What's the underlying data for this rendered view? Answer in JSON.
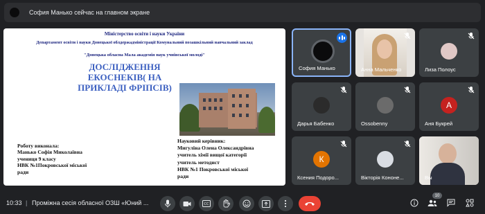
{
  "notification": {
    "text": "София Манько сейчас на главном экране"
  },
  "slide": {
    "line1": "Міністерство освіти і науки України",
    "line2": "Департамент освіти і науки Донецької облдержадміністрації  Комунальний позашкільний навчальний заклад",
    "line3": "\"Донецька обласна Мала академія наук учнівської молоді\"",
    "title": "ДОСЛІДЖЕННЯ  ЕКОСНЕКІВ( НА ПРИКЛАДІ ФРІПСІВ)",
    "left": [
      "Роботу виконала:",
      "Манько Софія Миколаївна",
      "учениця 9 класу",
      "НВК №1Покровської міської",
      "ради"
    ],
    "right": [
      "Науковий керівник:",
      "Мигуліна Олена Олександрівна",
      "учитель хімії вищої категорії",
      "учитель методист",
      "НВК №1 Покровської міської",
      "ради"
    ]
  },
  "participants": [
    {
      "name": "София Манько",
      "initial": ""
    },
    {
      "name": "Анна Мальченко",
      "initial": ""
    },
    {
      "name": "Лиза Полоус",
      "initial": ""
    },
    {
      "name": "Дарья Бабенко",
      "initial": ""
    },
    {
      "name": "Ossobenny",
      "initial": ""
    },
    {
      "name": "Аня Букрей",
      "initial": "А",
      "color": "#c5221f"
    },
    {
      "name": "Ксения Подоро...",
      "initial": "К",
      "color": "#e37400"
    },
    {
      "name": "Вікторія Кононе...",
      "initial": ""
    },
    {
      "name": "Вы",
      "initial": ""
    }
  ],
  "bottom_bar": {
    "time": "10:33",
    "separator": "|",
    "meeting_title": "Проміжна сесія обласної ОЗШ «Юний ...",
    "participant_count": "10"
  },
  "icons": [
    "mic-icon",
    "camera-icon",
    "captions-icon",
    "raise-hand-icon",
    "emoji-icon",
    "present-icon",
    "more-icon",
    "end-call-icon",
    "info-icon",
    "people-icon",
    "chat-icon",
    "activities-icon"
  ],
  "colors": {
    "background": "#202124",
    "tile": "#3c4043",
    "accent": "#1a73e8",
    "end_call": "#ea4335"
  }
}
